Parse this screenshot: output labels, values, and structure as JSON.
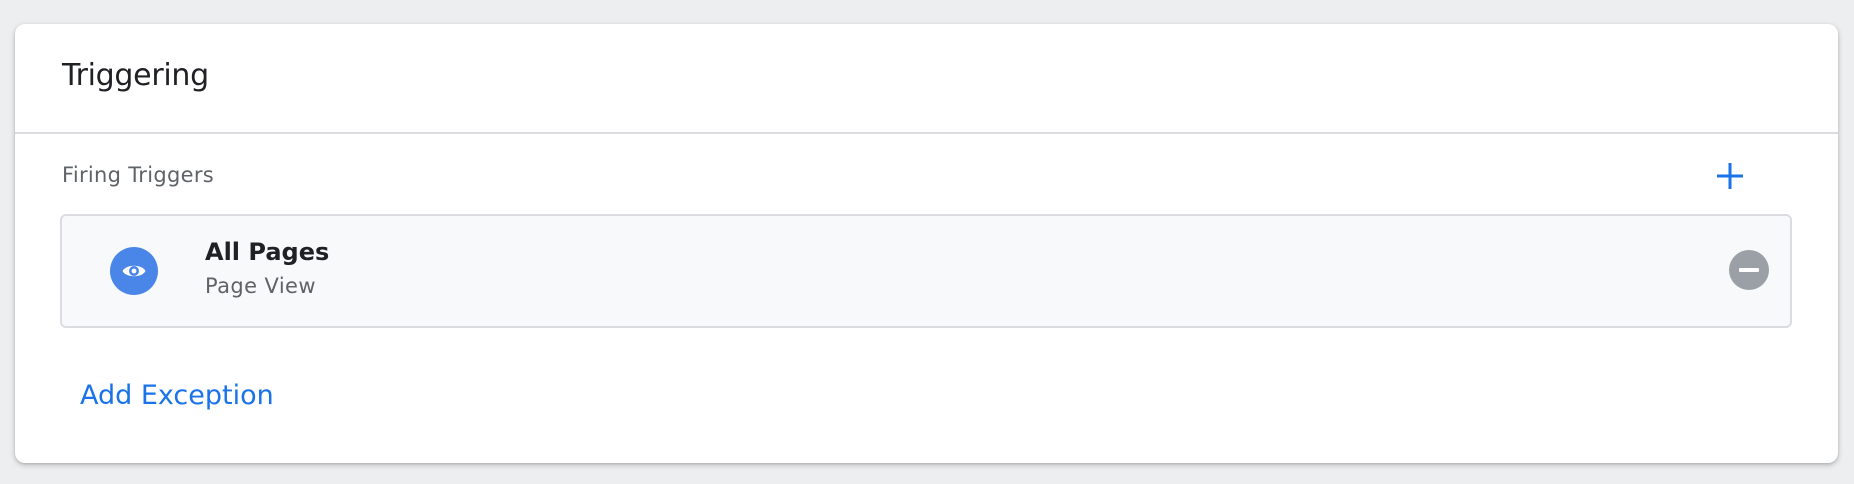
{
  "card": {
    "title": "Triggering"
  },
  "firing_triggers": {
    "label": "Firing Triggers",
    "add_icon": "plus-icon",
    "items": [
      {
        "name": "All Pages",
        "type": "Page View",
        "icon": "eye-icon",
        "remove_icon": "remove-circle-icon"
      }
    ]
  },
  "exceptions": {
    "add_label": "Add Exception"
  },
  "colors": {
    "accent": "#1a73e8",
    "trigger_icon_bg": "#4a86e8",
    "remove_icon_bg": "#9aa0a6"
  }
}
